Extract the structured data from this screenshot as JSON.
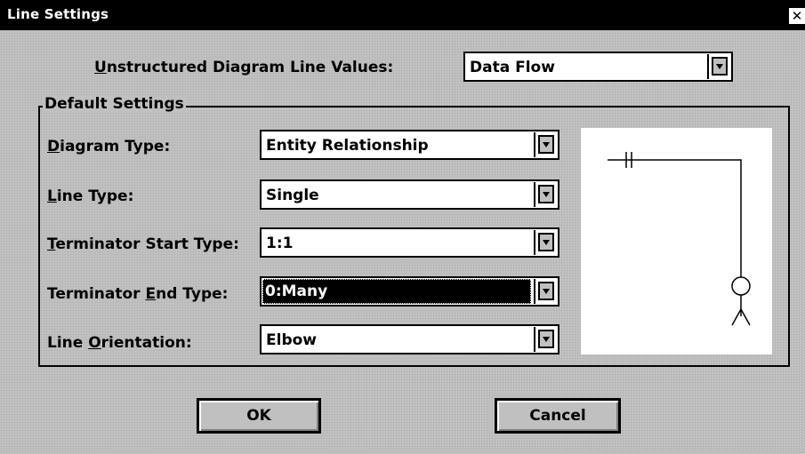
{
  "window": {
    "title": "Line Settings",
    "close_symbol": "✕"
  },
  "unstructured": {
    "label_key": "U",
    "label_rest": "nstructured Diagram Line Values:",
    "value": "Data Flow"
  },
  "group": {
    "title": "Default Settings"
  },
  "fields": [
    {
      "pre": "",
      "key": "D",
      "post": "iagram Type:",
      "value": "Entity Relationship"
    },
    {
      "pre": "",
      "key": "L",
      "post": "ine Type:",
      "value": "Single"
    },
    {
      "pre": "",
      "key": "T",
      "post": "erminator Start Type:",
      "value": "1:1"
    },
    {
      "pre": "Terminator ",
      "key": "E",
      "post": "nd Type:",
      "value": "0:Many"
    },
    {
      "pre": "Line ",
      "key": "O",
      "post": "rientation:",
      "value": "Elbow"
    }
  ],
  "buttons": {
    "ok": "OK",
    "cancel": "Cancel"
  },
  "preview": {
    "start_terminator": "1:1",
    "end_terminator": "0:Many",
    "orientation": "Elbow"
  }
}
